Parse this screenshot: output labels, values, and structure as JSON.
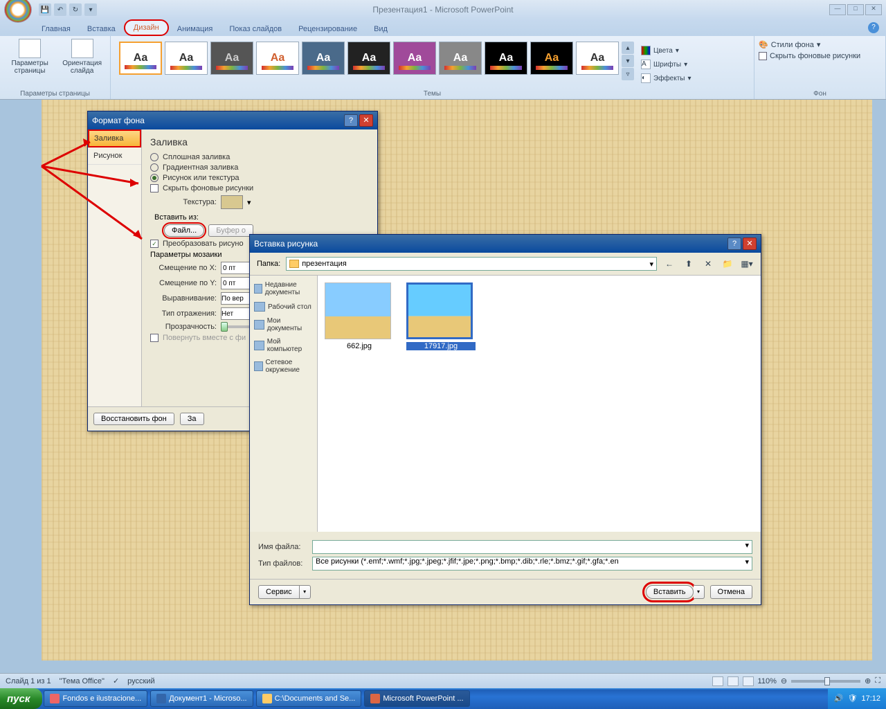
{
  "app": {
    "title": "Презентация1 - Microsoft PowerPoint"
  },
  "qat": {
    "save": "💾",
    "undo": "↶",
    "redo": "↻"
  },
  "tabs": [
    "Главная",
    "Вставка",
    "Дизайн",
    "Анимация",
    "Показ слайдов",
    "Рецензирование",
    "Вид"
  ],
  "ribbon": {
    "page_setup": {
      "params": "Параметры страницы",
      "orient": "Ориентация слайда",
      "group": "Параметры страницы"
    },
    "themes_group": "Темы",
    "theme_opts": {
      "colors": "Цвета",
      "fonts": "Шрифты",
      "effects": "Эффекты"
    },
    "bg": {
      "styles": "Стили фона",
      "hide": "Скрыть фоновые рисунки",
      "group": "Фон"
    }
  },
  "fmt": {
    "title": "Формат фона",
    "side": {
      "fill": "Заливка",
      "picture": "Рисунок"
    },
    "heading": "Заливка",
    "solid": "Сплошная заливка",
    "gradient": "Градиентная заливка",
    "picture_texture": "Рисунок или текстура",
    "hide_bg": "Скрыть фоновые рисунки",
    "texture": "Текстура:",
    "insert_from": "Вставить из:",
    "file_btn": "Файл...",
    "clipboard_btn": "Буфер о",
    "convert": "Преобразовать рисуно",
    "mosaic": "Параметры мозаики",
    "offset_x": "Смещение по X:",
    "offset_y": "Смещение по Y:",
    "offset_val": "0 пт",
    "align": "Выравнивание:",
    "align_val": "По вер",
    "mirror": "Тип отражения:",
    "mirror_val": "Нет",
    "transparency": "Прозрачность:",
    "rotate": "Повернуть вместе с фи",
    "reset": "Восстановить фон",
    "apply": "За"
  },
  "ins": {
    "title": "Вставка рисунка",
    "folder_label": "Папка:",
    "folder_value": "презентация",
    "places": [
      "Недавние документы",
      "Рабочий стол",
      "Мои документы",
      "Мой компьютер",
      "Сетевое окружение"
    ],
    "files": [
      {
        "name": "662.jpg",
        "selected": false
      },
      {
        "name": "17917.jpg",
        "selected": true
      }
    ],
    "filename_label": "Имя файла:",
    "filetype_label": "Тип файлов:",
    "filetype_value": "Все рисунки (*.emf;*.wmf;*.jpg;*.jpeg;*.jfif;*.jpe;*.png;*.bmp;*.dib;*.rle;*.bmz;*.gif;*.gfa;*.en",
    "service": "Сервис",
    "insert": "Вставить",
    "cancel": "Отмена"
  },
  "status": {
    "slide": "Слайд 1 из 1",
    "theme": "\"Тема Office\"",
    "lang": "русский",
    "zoom": "110%"
  },
  "taskbar": {
    "start": "пуск",
    "items": [
      "Fondos e ilustracione...",
      "Документ1 - Microso...",
      "C:\\Documents and Se...",
      "Microsoft PowerPoint ..."
    ],
    "time": "17:12"
  }
}
